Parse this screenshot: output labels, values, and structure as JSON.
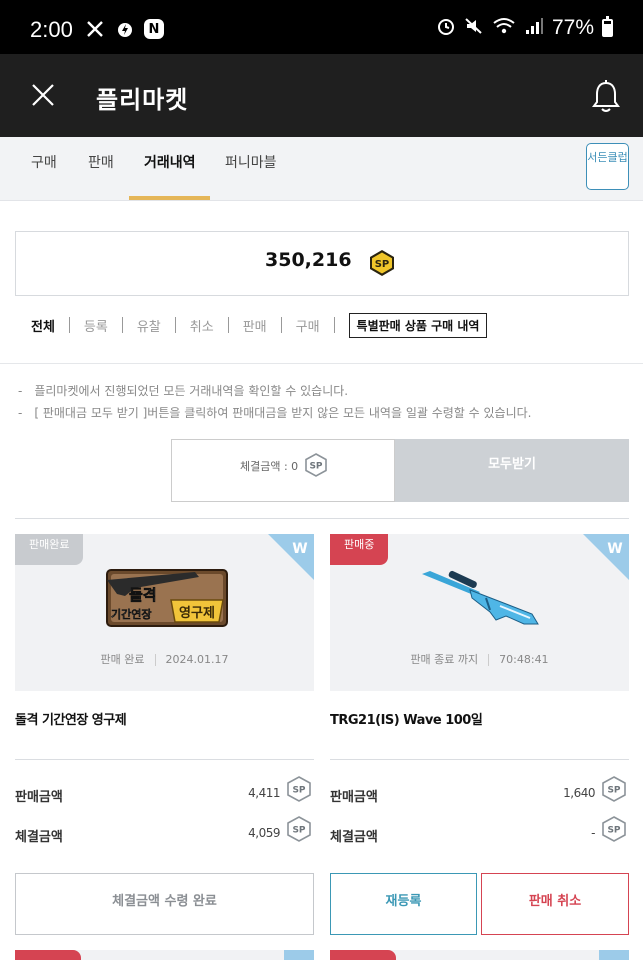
{
  "status_bar": {
    "time": "2:00",
    "battery": "77%",
    "battery_level": 0.77,
    "left_icons": [
      "missed-call-icon",
      "lightning-app-icon",
      "n-app-icon"
    ],
    "right_icons": [
      "alarm-icon",
      "mute-icon",
      "wifi-icon",
      "signal-icon",
      "battery-icon"
    ]
  },
  "header": {
    "title": "플리마켓",
    "close_icon": "close-icon",
    "bell_icon": "bell-icon"
  },
  "tabs": {
    "items": [
      {
        "label": "구매"
      },
      {
        "label": "판매"
      },
      {
        "label": "거래내역",
        "active": true
      },
      {
        "label": "퍼니마블"
      }
    ],
    "service_button": "서든클럽"
  },
  "balance": {
    "value": "350,216",
    "currency_icon": "sp-coin-gold-icon"
  },
  "filters": {
    "items": [
      "전체",
      "등록",
      "유찰",
      "취소",
      "판매",
      "구매"
    ],
    "active": "전체",
    "special_button": "특별판매 상품 구매 내역"
  },
  "notes": [
    "플리마켓에서 진행되었던 모든 거래내역을 확인할 수 있습니다.",
    "[ 판매대금 모두 받기 ]버튼을 클릭하여 판매대금을 받지 않은 모든 내역을 일괄 수령할 수 있습니다."
  ],
  "note_bullet": "-",
  "settle": {
    "label": "체결금액 : 0",
    "button": "모두받기"
  },
  "cards": [
    {
      "badge": "판매완료",
      "corner": "W",
      "image_text_1": "돌격",
      "image_text_2": "기간연장",
      "image_text_3": "영구제",
      "status": "판매 완료",
      "date": "2024.01.17",
      "name": "돌격 기간연장 영구제",
      "sale_label": "판매금액",
      "sale_value": "4,411",
      "settle_label": "체결금액",
      "settle_value": "4,059",
      "action": "체결금액 수령 완료"
    },
    {
      "badge": "판매중",
      "corner": "W",
      "status": "판매 종료 까지",
      "date": "70:48:41",
      "name": "TRG21(IS) Wave 100일",
      "sale_label": "판매금액",
      "sale_value": "1,640",
      "settle_label": "체결금액",
      "settle_value": "-",
      "action_1": "재등록",
      "action_2": "판매 취소"
    }
  ],
  "sp_label": "SP",
  "colors": {
    "header_bg": "#1f1f1f",
    "accent_gold": "#e5b658",
    "sale_red": "#d54452",
    "blue": "#3b98b5"
  }
}
